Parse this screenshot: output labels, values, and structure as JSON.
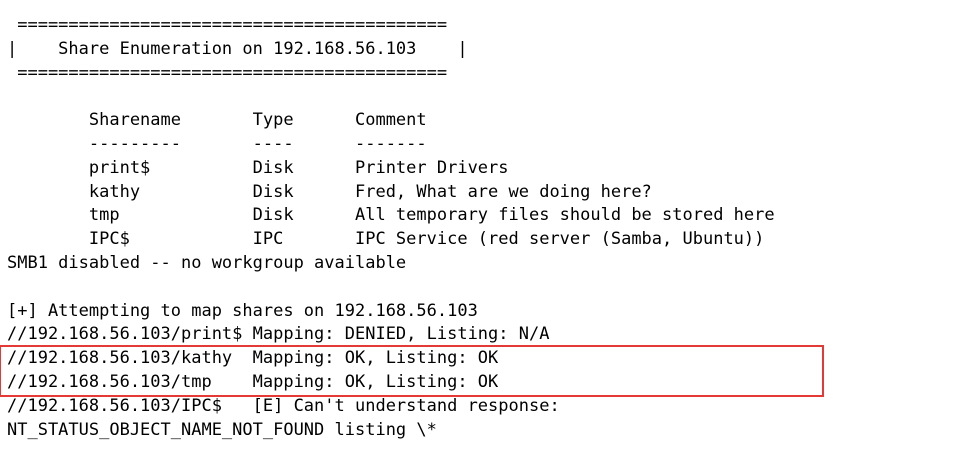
{
  "terminal": {
    "lines": [
      " ========================================== ",
      "|    Share Enumeration on 192.168.56.103    |",
      " ========================================== ",
      "",
      "        Sharename       Type      Comment",
      "        ---------       ----      -------",
      "        print$          Disk      Printer Drivers",
      "        kathy           Disk      Fred, What are we doing here?",
      "        tmp             Disk      All temporary files should be stored here",
      "        IPC$            IPC       IPC Service (red server (Samba, Ubuntu))",
      "SMB1 disabled -- no workgroup available",
      "",
      "[+] Attempting to map shares on 192.168.56.103",
      "//192.168.56.103/print$ Mapping: DENIED, Listing: N/A",
      "//192.168.56.103/kathy  Mapping: OK, Listing: OK",
      "//192.168.56.103/tmp    Mapping: OK, Listing: OK",
      "//192.168.56.103/IPC$   [E] Can't understand response:",
      "NT_STATUS_OBJECT_NAME_NOT_FOUND listing \\*"
    ]
  },
  "highlight": {
    "color": "#e53935"
  }
}
